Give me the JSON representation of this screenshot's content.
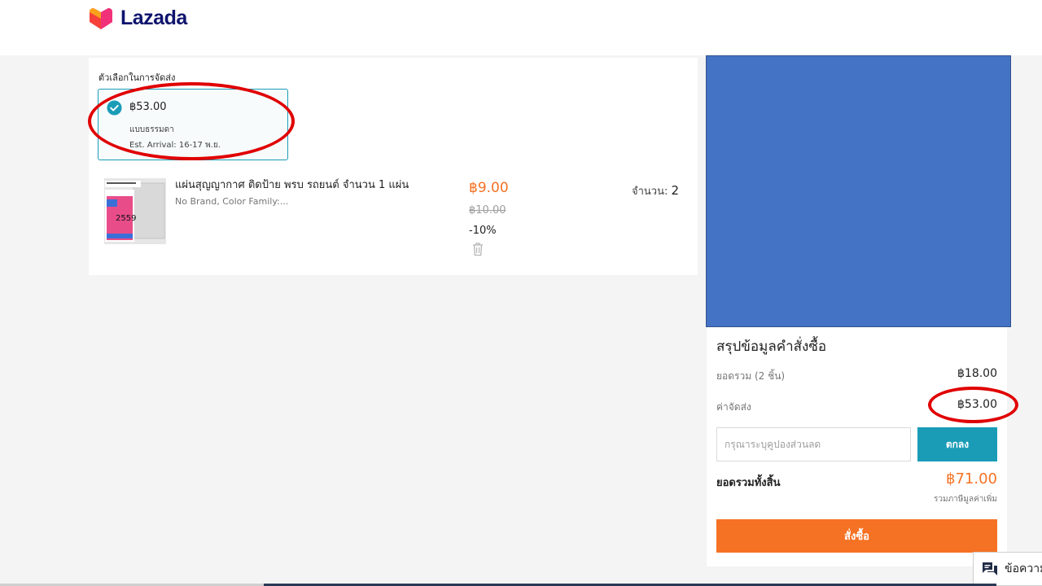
{
  "header": {
    "logo_text": "Lazada",
    "logo_colors": [
      "#f9a11b",
      "#f2317b",
      "#f5413a"
    ]
  },
  "shipping": {
    "section_label": "ตัวเลือกในการจัดส่ง",
    "option": {
      "price": "฿53.00",
      "type": "แบบธรรมดา",
      "eta": "Est. Arrival: 16-17 พ.ย.",
      "selected": true
    }
  },
  "product": {
    "title": "แผ่นสุญญากาศ ติดป้าย พรบ รถยนต์ จำนวน 1 แผ่น",
    "variant": "No Brand, Color Family:...",
    "price": "฿9.00",
    "original_price": "฿10.00",
    "discount": "-10%",
    "qty_label": "จำนวน:",
    "qty_value": "2",
    "thumb_year": "2559"
  },
  "summary": {
    "title": "สรุปข้อมูลคำสั่งซื้อ",
    "subtotal_label": "ยอดรวม (2 ชิ้น)",
    "subtotal_value": "฿18.00",
    "shipping_label": "ค่าจัดส่ง",
    "shipping_value": "฿53.00",
    "voucher_placeholder": "กรุณาระบุคูปองส่วนลด",
    "apply_label": "ตกลง",
    "total_label": "ยอดรวมทั้งสิ้น",
    "total_value": "฿71.00",
    "vat_note": "รวมภาษีมูลค่าเพิ่ม",
    "checkout_label": "สั่งซื้อ"
  },
  "chat": {
    "label": "ข้อความ"
  },
  "colors": {
    "accent_orange": "#f57224",
    "accent_teal": "#1a9cb7",
    "highlight_red": "#e00000",
    "placeholder_blue": "#4472c4"
  }
}
